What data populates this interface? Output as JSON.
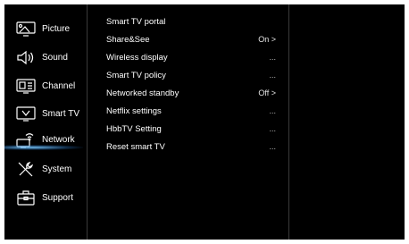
{
  "sidebar": {
    "items": [
      {
        "label": "Picture",
        "icon": "picture-icon"
      },
      {
        "label": "Sound",
        "icon": "speaker-icon"
      },
      {
        "label": "Channel",
        "icon": "channel-icon"
      },
      {
        "label": "Smart TV",
        "icon": "tv-icon"
      },
      {
        "label": "Network",
        "icon": "network-icon"
      },
      {
        "label": "System",
        "icon": "tools-icon"
      },
      {
        "label": "Support",
        "icon": "toolbox-icon"
      }
    ],
    "active": "Smart TV",
    "selected": "Network"
  },
  "menu": {
    "items": [
      {
        "label": "Smart TV portal",
        "value": ""
      },
      {
        "label": "Share&See",
        "value": "On >"
      },
      {
        "label": "Wireless display",
        "value": "..."
      },
      {
        "label": "Smart TV policy",
        "value": "..."
      },
      {
        "label": "Networked standby",
        "value": "Off >"
      },
      {
        "label": "Netflix settings",
        "value": "..."
      },
      {
        "label": "HbbTV Setting",
        "value": "..."
      },
      {
        "label": "Reset smart TV",
        "value": "..."
      }
    ]
  },
  "colors": {
    "background": "#000000",
    "text": "#ffffff",
    "highlight_glow": "#78c8ff"
  }
}
